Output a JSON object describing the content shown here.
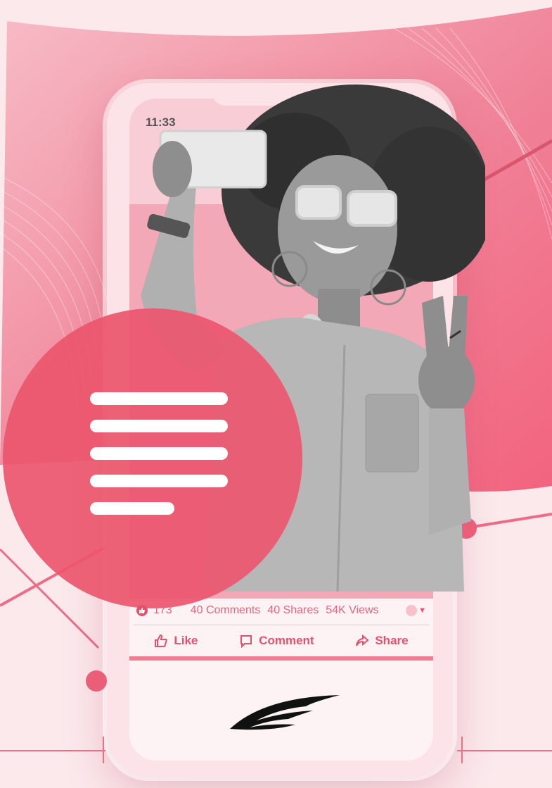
{
  "status_bar": {
    "time": "11:33"
  },
  "post": {
    "stats": {
      "like_count": "173",
      "comments": "40 Comments",
      "shares": "40 Shares",
      "views": "54K Views"
    },
    "actions": {
      "like_label": "Like",
      "comment_label": "Comment",
      "share_label": "Share"
    }
  },
  "icons": [
    "like-reaction-icon",
    "thumbs-up-icon",
    "comment-bubble-icon",
    "share-arrow-icon",
    "caret-down-icon",
    "wing-logo-icon"
  ],
  "colors": {
    "accent": "#e5506d",
    "background": "#fbe9ec",
    "circle": "#ec566e"
  }
}
